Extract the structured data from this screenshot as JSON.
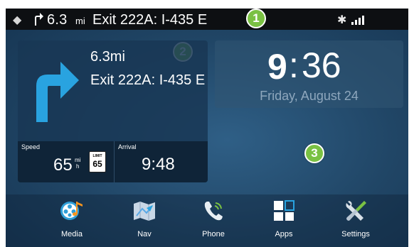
{
  "status_bar": {
    "distance": "6.3",
    "distance_unit": "mi",
    "exit": "Exit 222A: I-435 E",
    "bluetooth_icon": "bluetooth-icon",
    "signal_icon": "signal-bars-icon"
  },
  "markers": [
    "1",
    "2",
    "3"
  ],
  "navigation_card": {
    "distance": "6.3mi",
    "exit": "Exit 222A: I-435 E",
    "turn_icon": "turn-right-arrow-icon",
    "speed_label": "Speed",
    "speed_value": "65",
    "speed_unit_top": "mi",
    "speed_unit_bottom": "h",
    "limit_word": "LIMIT",
    "limit_value": "65",
    "arrival_label": "Arrival",
    "arrival_time": "9:48"
  },
  "clock": {
    "hour": "9",
    "separator": ":",
    "minutes": "36",
    "date": "Friday, August 24"
  },
  "dock": {
    "items": [
      {
        "label": "Media",
        "icon": "media-icon"
      },
      {
        "label": "Nav",
        "icon": "map-icon"
      },
      {
        "label": "Phone",
        "icon": "phone-icon"
      },
      {
        "label": "Apps",
        "icon": "apps-grid-icon"
      },
      {
        "label": "Settings",
        "icon": "wrench-screwdriver-icon"
      }
    ]
  },
  "colors": {
    "marker": "#7ac143",
    "background": "#204565",
    "status_bar": "#0d0f12",
    "turn_arrow": "#29a3e0"
  }
}
